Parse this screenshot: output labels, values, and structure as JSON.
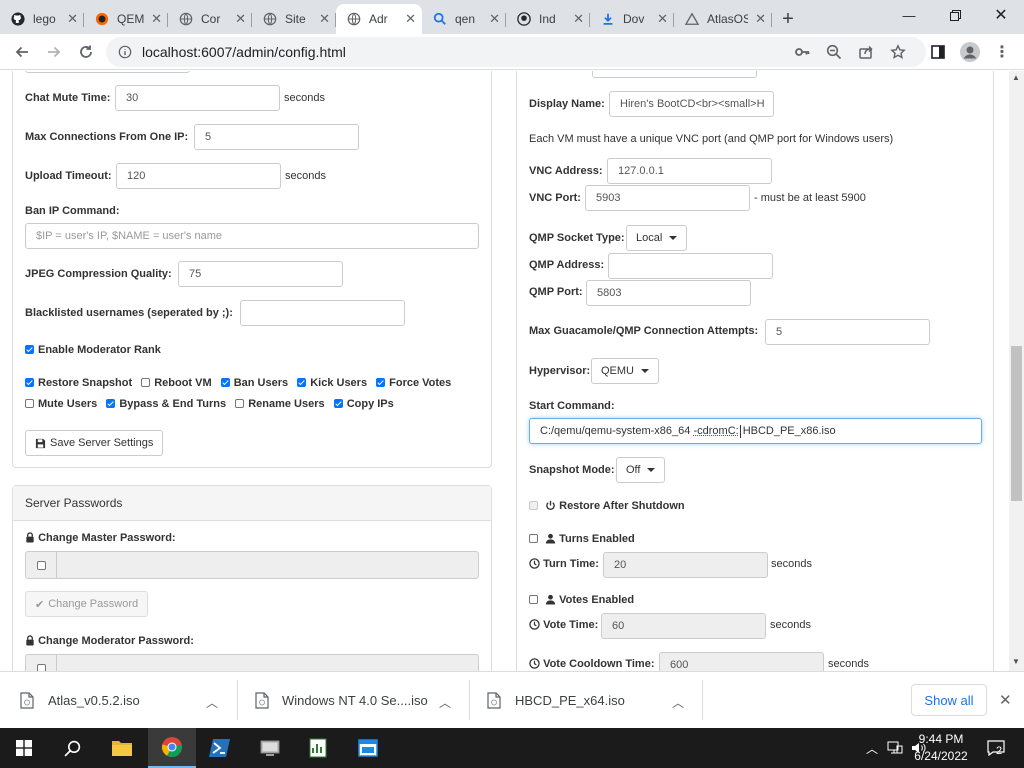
{
  "browser": {
    "tabs": [
      {
        "label": "lego",
        "icon": "github-icon"
      },
      {
        "label": "QEM",
        "icon": "qemu-icon"
      },
      {
        "label": "Cor",
        "icon": "globe-icon"
      },
      {
        "label": "Site",
        "icon": "globe-icon"
      },
      {
        "label": "Adr",
        "icon": "globe-icon",
        "active": true
      },
      {
        "label": "qen",
        "icon": "search-icon"
      },
      {
        "label": "Ind",
        "icon": "github-octocat-icon"
      },
      {
        "label": "Dov",
        "icon": "download-icon"
      },
      {
        "label": "AtlasOS",
        "icon": "triangle-icon"
      }
    ],
    "url": "localhost:6007/admin/config.html"
  },
  "left": {
    "chat_mute_label": "Chat Mute Time:",
    "chat_mute_value": "30",
    "chat_mute_unit": "seconds",
    "max_conn_label": "Max Connections From One IP:",
    "max_conn_value": "5",
    "upload_timeout_label": "Upload Timeout:",
    "upload_timeout_value": "120",
    "upload_timeout_unit": "seconds",
    "ban_ip_label": "Ban IP Command:",
    "ban_ip_placeholder": "$IP = user's IP, $NAME = user's name",
    "jpeg_label": "JPEG Compression Quality:",
    "jpeg_value": "75",
    "blacklist_label": "Blacklisted usernames (seperated by ;):",
    "blacklist_value": "",
    "enable_mod_label": "Enable Moderator Rank",
    "perm_restore": "Restore Snapshot",
    "perm_reboot": "Reboot VM",
    "perm_ban": "Ban Users",
    "perm_kick": "Kick Users",
    "perm_force": "Force Votes",
    "perm_mute": "Mute Users",
    "perm_bypass": "Bypass & End Turns",
    "perm_rename": "Rename Users",
    "perm_copyip": "Copy IPs",
    "save_label": "Save Server Settings",
    "passwords_heading": "Server Passwords",
    "master_pw_label": "Change Master Password:",
    "change_pw_label": "Change Password",
    "mod_pw_label": "Change Moderator Password:"
  },
  "right": {
    "display_name_label": "Display Name:",
    "display_name_value": "Hiren's BootCD<br><small>H",
    "vnc_note": "Each VM must have a unique VNC port (and QMP port for Windows users)",
    "vnc_addr_label": "VNC Address:",
    "vnc_addr_value": "127.0.0.1",
    "vnc_port_label": "VNC Port:",
    "vnc_port_value": "5903",
    "vnc_port_note": "- must be at least 5900",
    "qmp_type_label": "QMP Socket Type:",
    "qmp_type_value": "Local",
    "qmp_addr_label": "QMP Address:",
    "qmp_addr_value": "",
    "qmp_port_label": "QMP Port:",
    "qmp_port_value": "5803",
    "max_attempts_label": "Max Guacamole/QMP Connection Attempts:",
    "max_attempts_value": "5",
    "hypervisor_label": "Hypervisor:",
    "hypervisor_value": "QEMU",
    "start_cmd_label": "Start Command:",
    "start_cmd_prefix": "C:/qemu/qemu-system-x86_64 ",
    "start_cmd_flag": "-cdrom",
    "start_cmd_drive": "C:",
    "start_cmd_suffix": "HBCD_PE_x86.iso",
    "snapshot_label": "Snapshot Mode:",
    "snapshot_value": "Off",
    "restore_shutdown_label": "Restore After Shutdown",
    "turns_label": "Turns Enabled",
    "turn_time_label": "Turn Time:",
    "turn_time_value": "20",
    "turn_time_unit": "seconds",
    "votes_label": "Votes Enabled",
    "vote_time_label": "Vote Time:",
    "vote_time_value": "60",
    "vote_time_unit": "seconds",
    "vote_cooldown_label": "Vote Cooldown Time:",
    "vote_cooldown_value": "600",
    "vote_cooldown_unit": "seconds"
  },
  "downloads": {
    "items": [
      "Atlas_v0.5.2.iso",
      "Windows NT 4.0 Se....iso",
      "HBCD_PE_x64.iso"
    ],
    "show_all": "Show all"
  },
  "taskbar": {
    "time": "9:44 PM",
    "date": "6/24/2022",
    "notification_count": "2"
  },
  "colors": {
    "checkbox_on": "#0075ff",
    "focus_border": "#66afe9",
    "link_blue": "#1a73e8",
    "taskbar_bg": "#1b1b1b"
  }
}
